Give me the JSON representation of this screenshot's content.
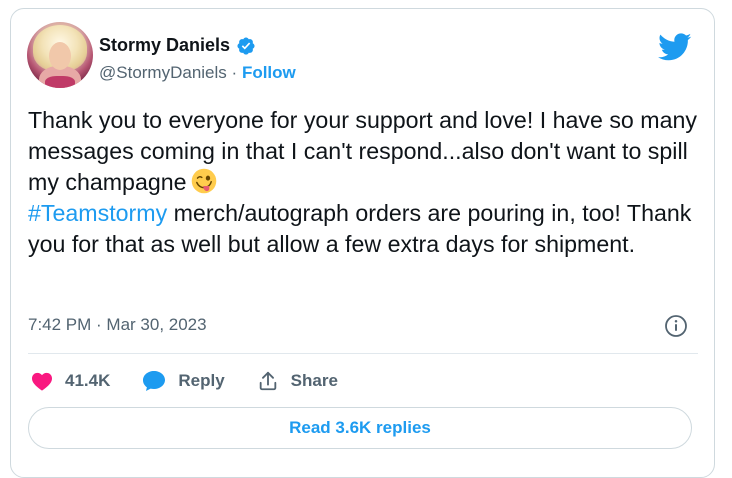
{
  "author": {
    "name": "Stormy Daniels",
    "handle": "@StormyDaniels",
    "separator": "·",
    "follow_label": "Follow",
    "verified": true
  },
  "tweet": {
    "text_before_hashtag": "Thank you to everyone for your support and love! I have so many messages coming in that I can't respond...also don't want to spill my champagne",
    "emoji": "winking-face-with-tongue",
    "hashtag": "#Teamstormy",
    "text_after_hashtag": " merch/autograph orders are pouring in, too! Thank you for that as well but allow a few extra days for shipment.",
    "timestamp": "7:42 PM · Mar 30, 2023"
  },
  "actions": {
    "like_count": "41.4K",
    "reply_label": "Reply",
    "share_label": "Share"
  },
  "read_replies_label": "Read 3.6K replies",
  "colors": {
    "accent": "#1d9bf0",
    "like": "#f91880",
    "text": "#0f1419",
    "muted": "#536471",
    "border": "#cfd9de"
  }
}
